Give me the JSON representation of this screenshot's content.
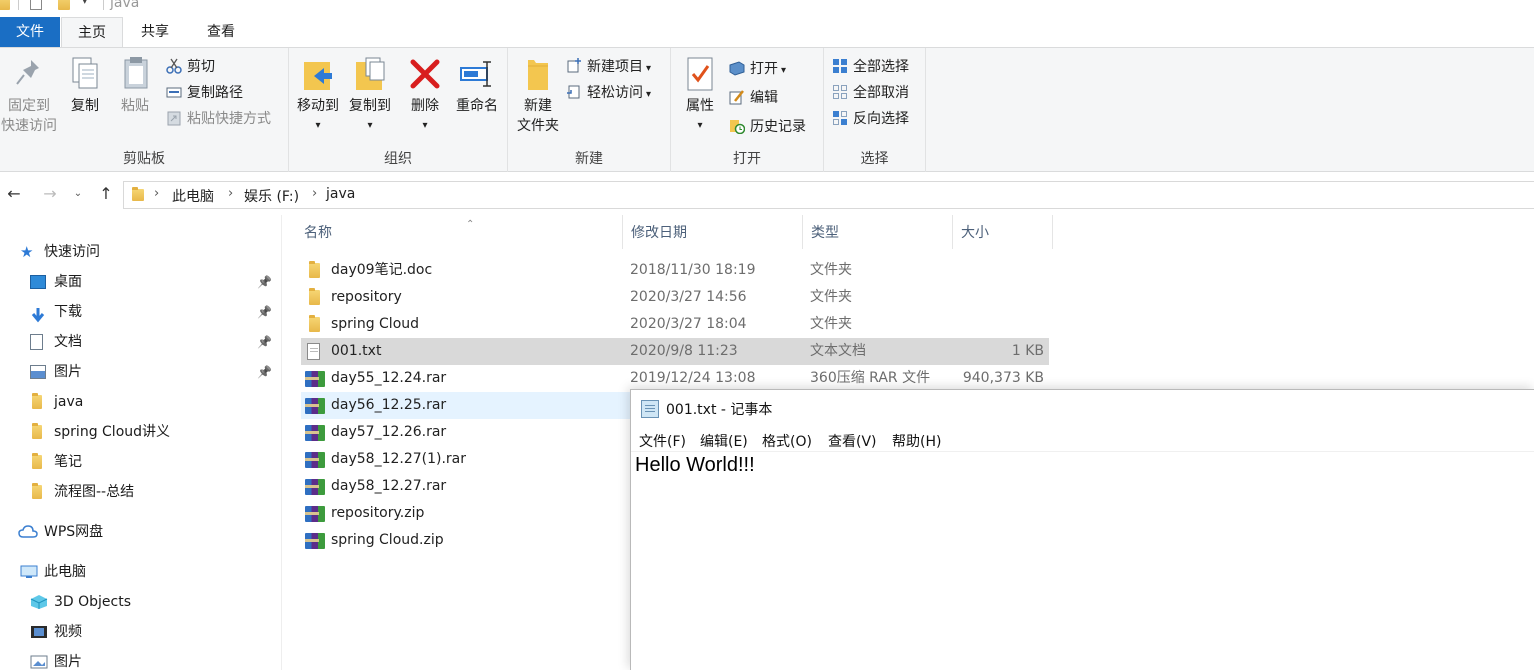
{
  "title_bar": {
    "title": "java"
  },
  "tabs": {
    "file": "文件",
    "home": "主页",
    "share": "共享",
    "view": "查看"
  },
  "ribbon": {
    "clipboard": {
      "label": "剪贴板",
      "pin": "固定到\n快速访问",
      "pin_line1": "固定到",
      "pin_line2": "快速访问",
      "copy": "复制",
      "paste": "粘贴",
      "cut": "剪切",
      "copy_path": "复制路径",
      "paste_shortcut": "粘贴快捷方式"
    },
    "organize": {
      "label": "组织",
      "move_to": "移动到",
      "copy_to": "复制到",
      "delete": "删除",
      "rename": "重命名"
    },
    "new": {
      "label": "新建",
      "new_folder_line1": "新建",
      "new_folder_line2": "文件夹",
      "new_item": "新建项目",
      "easy_access": "轻松访问"
    },
    "open": {
      "label": "打开",
      "properties": "属性",
      "open": "打开",
      "edit": "编辑",
      "history": "历史记录"
    },
    "select": {
      "label": "选择",
      "select_all": "全部选择",
      "select_none": "全部取消",
      "invert": "反向选择"
    }
  },
  "address": {
    "crumbs": [
      "此电脑",
      "娱乐 (F:)",
      "java"
    ]
  },
  "nav": {
    "quick_access": "快速访问",
    "items": [
      {
        "label": "桌面",
        "pinned": true
      },
      {
        "label": "下载",
        "pinned": true
      },
      {
        "label": "文档",
        "pinned": true
      },
      {
        "label": "图片",
        "pinned": true
      },
      {
        "label": "java",
        "pinned": false
      },
      {
        "label": "spring Cloud讲义",
        "pinned": false
      },
      {
        "label": "笔记",
        "pinned": false
      },
      {
        "label": "流程图--总结",
        "pinned": false
      }
    ],
    "wps": "WPS网盘",
    "this_pc": "此电脑",
    "pc_items": [
      "3D Objects",
      "视频",
      "图片"
    ]
  },
  "columns": {
    "name": "名称",
    "date": "修改日期",
    "type": "类型",
    "size": "大小"
  },
  "files": [
    {
      "name": "day09笔记.doc",
      "date": "2018/11/30 18:19",
      "type": "文件夹",
      "size": "",
      "icon": "folder-icon"
    },
    {
      "name": "repository",
      "date": "2020/3/27 14:56",
      "type": "文件夹",
      "size": "",
      "icon": "folder-icon"
    },
    {
      "name": "spring Cloud",
      "date": "2020/3/27 18:04",
      "type": "文件夹",
      "size": "",
      "icon": "folder-icon"
    },
    {
      "name": "001.txt",
      "date": "2020/9/8 11:23",
      "type": "文本文档",
      "size": "1 KB",
      "icon": "text-file-icon"
    },
    {
      "name": "day55_12.24.rar",
      "date": "2019/12/24 13:08",
      "type": "360压缩 RAR 文件",
      "size": "940,373 KB",
      "icon": "rar-icon"
    },
    {
      "name": "day56_12.25.rar",
      "date": "",
      "type": "",
      "size": "",
      "icon": "rar-icon"
    },
    {
      "name": "day57_12.26.rar",
      "date": "",
      "type": "",
      "size": "",
      "icon": "rar-icon"
    },
    {
      "name": "day58_12.27(1).rar",
      "date": "",
      "type": "",
      "size": "",
      "icon": "rar-icon"
    },
    {
      "name": "day58_12.27.rar",
      "date": "",
      "type": "",
      "size": "",
      "icon": "rar-icon"
    },
    {
      "name": "repository.zip",
      "date": "",
      "type": "",
      "size": "",
      "icon": "rar-icon"
    },
    {
      "name": "spring Cloud.zip",
      "date": "",
      "type": "",
      "size": "",
      "icon": "rar-icon"
    }
  ],
  "notepad": {
    "title": "001.txt - 记事本",
    "menu": [
      "文件(F)",
      "编辑(E)",
      "格式(O)",
      "查看(V)",
      "帮助(H)"
    ],
    "content": "Hello World!!!"
  },
  "colors": {
    "accent": "#1a6ec4",
    "selected_row": "#d9d9d9",
    "hover_row": "#e5f3ff"
  }
}
